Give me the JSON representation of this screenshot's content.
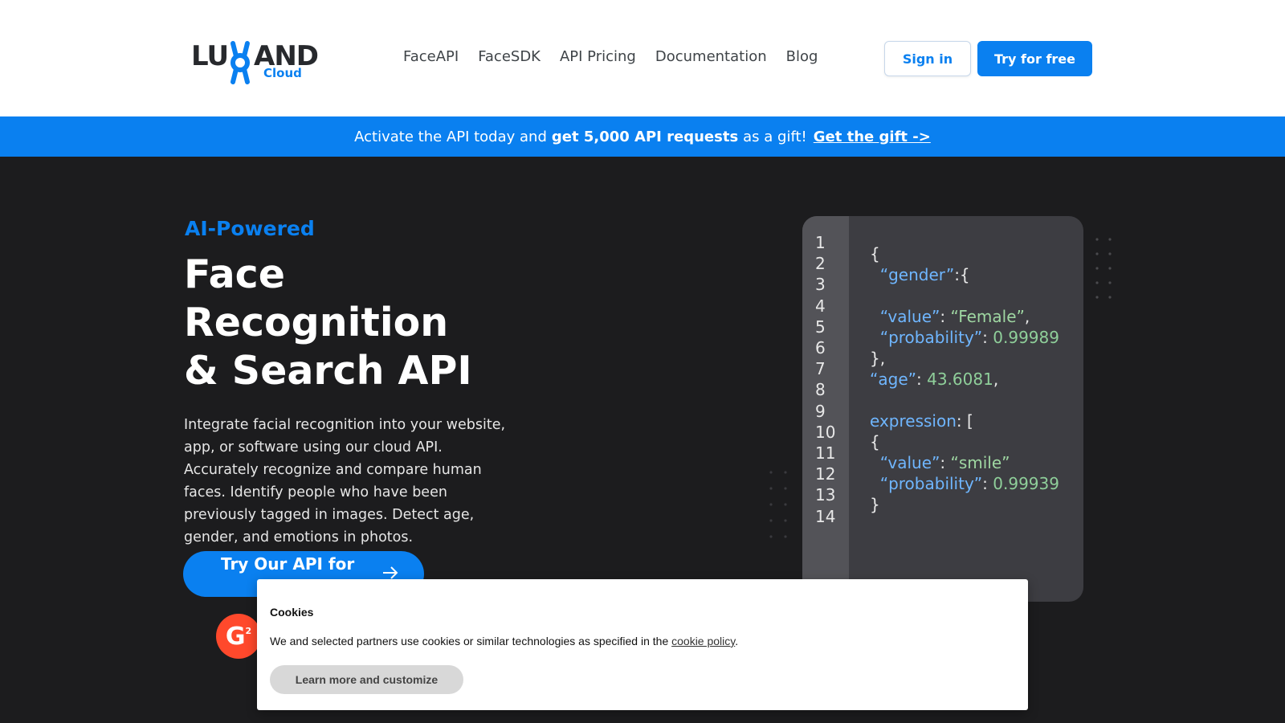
{
  "header": {
    "logo_text_left": "LU",
    "logo_text_right": "AND",
    "logo_sub": "Cloud",
    "nav": [
      "FaceAPI",
      "FaceSDK",
      "API Pricing",
      "Documentation",
      "Blog"
    ],
    "signin_label": "Sign in",
    "try_label": "Try for free"
  },
  "promo": {
    "prefix": "Activate the API today and",
    "highlight": "get 5,000 API requests",
    "suffix": "as a gift!",
    "link": "Get the gift ->"
  },
  "hero": {
    "eyebrow": "AI-Powered",
    "title_lines": [
      "Face",
      "Recognition",
      "& Search API"
    ],
    "description": "Integrate facial recognition into your website, app, or software using our cloud API. Accurately recognize and compare human faces. Identify people who have been previously tagged in images. Detect age, gender, and emotions in photos.",
    "cta_label": "Try Our API for",
    "badge_label": "G",
    "badge_sup": "2"
  },
  "code_card": {
    "line_numbers": [
      "1",
      "2",
      "3",
      "4",
      "5",
      "6",
      "7",
      "8",
      "9",
      "10",
      "11",
      "12",
      "13",
      "14"
    ]
  },
  "cookie": {
    "title": "Cookies",
    "text_prefix": "We and selected partners use cookies or similar technologies as specified in the",
    "link": "cookie policy",
    "text_suffix": ".",
    "button": "Learn more and customize"
  },
  "colors": {
    "accent": "#0a80f0",
    "dark_bg": "#1c1c1e",
    "g2_red": "#ff492c"
  }
}
